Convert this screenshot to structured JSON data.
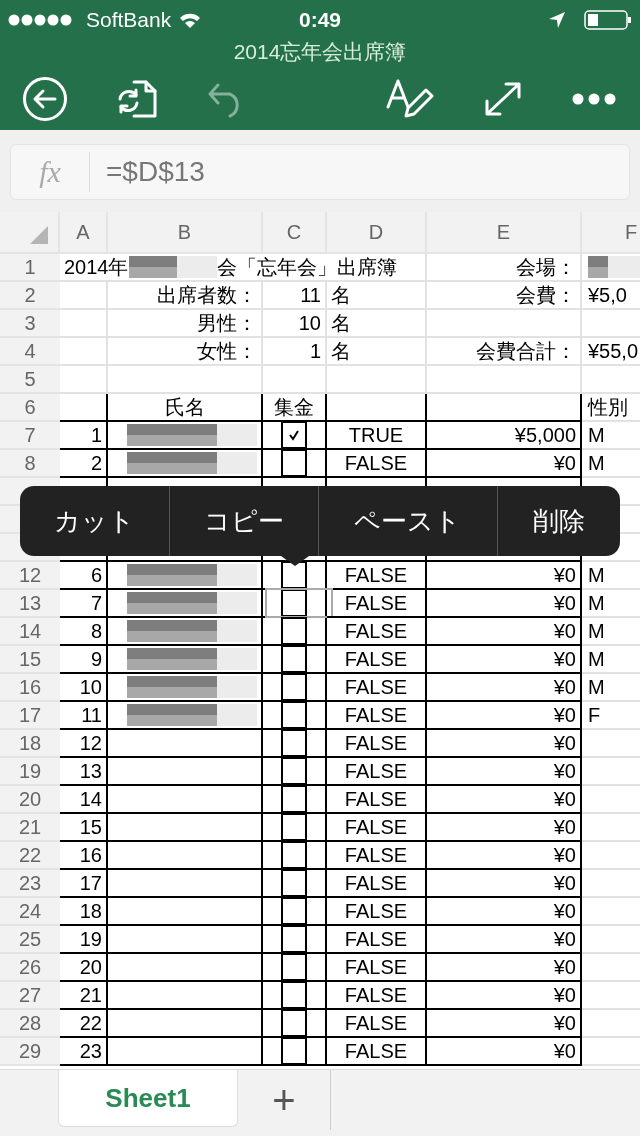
{
  "status_bar": {
    "carrier": "SoftBank",
    "time": "0:49"
  },
  "window": {
    "title": "2014忘年会出席簿"
  },
  "toolbar": {
    "undo_disabled": true
  },
  "formula_bar": {
    "fx_label": "fx",
    "value": "=$D$13"
  },
  "columns": [
    "A",
    "B",
    "C",
    "D",
    "E",
    "F"
  ],
  "rows": [
    {
      "kind": "title",
      "number": "1",
      "a": "2014年",
      "a_blurred": true,
      "a_after": "会「忘年会」出席簿",
      "e": "会場：",
      "f_blurred": true
    },
    {
      "kind": "info",
      "number": "2",
      "b": "出席者数：",
      "c": "11",
      "d": "名",
      "e": "会費：",
      "f": "¥5,0"
    },
    {
      "kind": "info",
      "number": "3",
      "b": "男性：",
      "c": "10",
      "d": "名"
    },
    {
      "kind": "info",
      "number": "4",
      "b": "女性：",
      "c": "1",
      "d": "名",
      "e": "会費合計：",
      "f": "¥55,0"
    },
    {
      "kind": "blank",
      "number": "5"
    },
    {
      "kind": "header",
      "number": "6",
      "b": "氏名",
      "c": "集金",
      "f": "性別"
    },
    {
      "kind": "entry",
      "number": "7",
      "a": "1",
      "name_blurred": true,
      "checked": true,
      "selected": false,
      "d": "TRUE",
      "e": "¥5,000",
      "f": "M"
    },
    {
      "kind": "entry",
      "number": "8",
      "a": "2",
      "name_blurred": true,
      "checked": false,
      "selected": false,
      "d": "FALSE",
      "e": "¥0",
      "f": "M"
    },
    {
      "kind": "covered"
    },
    {
      "kind": "covered"
    },
    {
      "kind": "covered"
    },
    {
      "kind": "entry",
      "number": "12",
      "a": "6",
      "name_blurred": true,
      "checked": false,
      "selected": false,
      "d": "FALSE",
      "e": "¥0",
      "f": "M"
    },
    {
      "kind": "entry",
      "number": "13",
      "a": "7",
      "name_blurred": true,
      "checked": false,
      "selected": true,
      "d": "FALSE",
      "e": "¥0",
      "f": "M"
    },
    {
      "kind": "entry",
      "number": "14",
      "a": "8",
      "name_blurred": true,
      "checked": false,
      "selected": false,
      "d": "FALSE",
      "e": "¥0",
      "f": "M"
    },
    {
      "kind": "entry",
      "number": "15",
      "a": "9",
      "name_blurred": true,
      "checked": false,
      "selected": false,
      "d": "FALSE",
      "e": "¥0",
      "f": "M"
    },
    {
      "kind": "entry",
      "number": "16",
      "a": "10",
      "name_blurred": true,
      "checked": false,
      "selected": false,
      "d": "FALSE",
      "e": "¥0",
      "f": "M"
    },
    {
      "kind": "entry",
      "number": "17",
      "a": "11",
      "name_blurred": true,
      "checked": false,
      "selected": false,
      "d": "FALSE",
      "e": "¥0",
      "f": "F"
    },
    {
      "kind": "entry",
      "number": "18",
      "a": "12",
      "name_blurred": false,
      "checked": false,
      "selected": false,
      "d": "FALSE",
      "e": "¥0"
    },
    {
      "kind": "entry",
      "number": "19",
      "a": "13",
      "name_blurred": false,
      "checked": false,
      "selected": false,
      "d": "FALSE",
      "e": "¥0"
    },
    {
      "kind": "entry",
      "number": "20",
      "a": "14",
      "name_blurred": false,
      "checked": false,
      "selected": false,
      "d": "FALSE",
      "e": "¥0"
    },
    {
      "kind": "entry",
      "number": "21",
      "a": "15",
      "name_blurred": false,
      "checked": false,
      "selected": false,
      "d": "FALSE",
      "e": "¥0"
    },
    {
      "kind": "entry",
      "number": "22",
      "a": "16",
      "name_blurred": false,
      "checked": false,
      "selected": false,
      "d": "FALSE",
      "e": "¥0"
    },
    {
      "kind": "entry",
      "number": "23",
      "a": "17",
      "name_blurred": false,
      "checked": false,
      "selected": false,
      "d": "FALSE",
      "e": "¥0"
    },
    {
      "kind": "entry",
      "number": "24",
      "a": "18",
      "name_blurred": false,
      "checked": false,
      "selected": false,
      "d": "FALSE",
      "e": "¥0"
    },
    {
      "kind": "entry",
      "number": "25",
      "a": "19",
      "name_blurred": false,
      "checked": false,
      "selected": false,
      "d": "FALSE",
      "e": "¥0"
    },
    {
      "kind": "entry",
      "number": "26",
      "a": "20",
      "name_blurred": false,
      "checked": false,
      "selected": false,
      "d": "FALSE",
      "e": "¥0"
    },
    {
      "kind": "entry",
      "number": "27",
      "a": "21",
      "name_blurred": false,
      "checked": false,
      "selected": false,
      "d": "FALSE",
      "e": "¥0"
    },
    {
      "kind": "entry",
      "number": "28",
      "a": "22",
      "name_blurred": false,
      "checked": false,
      "selected": false,
      "d": "FALSE",
      "e": "¥0"
    },
    {
      "kind": "entry",
      "number": "29",
      "a": "23",
      "name_blurred": false,
      "checked": false,
      "selected": false,
      "d": "FALSE",
      "e": "¥0"
    }
  ],
  "context_menu": [
    "カット",
    "コピー",
    "ペースト",
    "削除"
  ],
  "sheet_tabs": [
    {
      "label": "Sheet1",
      "selected": true
    }
  ],
  "add_sheet": "+"
}
